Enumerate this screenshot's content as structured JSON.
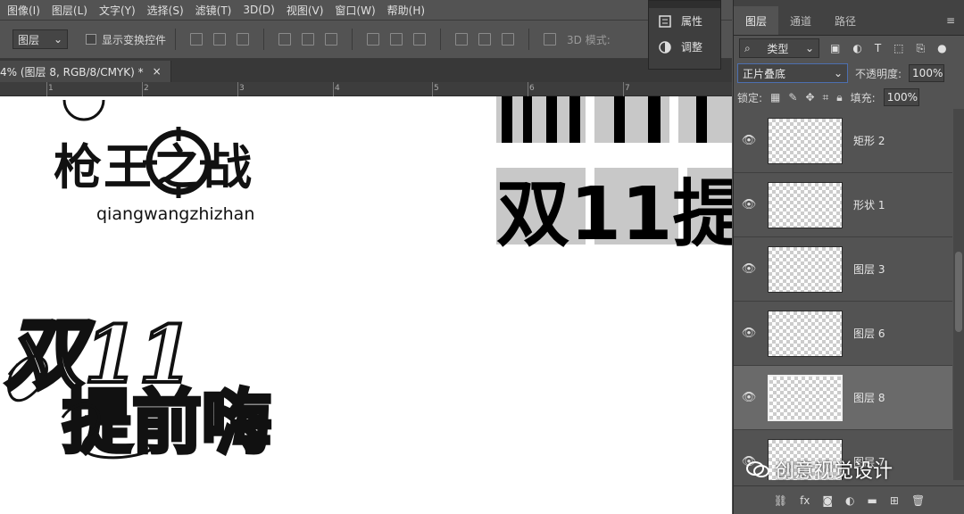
{
  "menu": [
    "图像(I)",
    "图层(L)",
    "文字(Y)",
    "选择(S)",
    "滤镜(T)",
    "3D(D)",
    "视图(V)",
    "窗口(W)",
    "帮助(H)"
  ],
  "options": {
    "select_value": "图层",
    "checkbox_label": "显示变换控件",
    "mode_3d": "3D 模式:"
  },
  "doc_tab": {
    "title": "4% (图层 8, RGB/8/CMYK) *",
    "close": "×"
  },
  "ruler": {
    "ticks": [
      "1",
      "2",
      "3",
      "4",
      "5",
      "6",
      "7"
    ]
  },
  "float_panel": {
    "item1": "属性",
    "item2": "调整"
  },
  "layers_panel": {
    "tabs": [
      "图层",
      "通道",
      "路径"
    ],
    "filter_kind": "类型",
    "blend_mode": "正片叠底",
    "opacity_label": "不透明度:",
    "opacity_value": "100%",
    "lock_label": "锁定:",
    "fill_label": "填充:",
    "fill_value": "100%",
    "layers": [
      {
        "name": "矩形 2"
      },
      {
        "name": "形状 1"
      },
      {
        "name": "图层 3"
      },
      {
        "name": "图层 6"
      },
      {
        "name": "图层 8"
      },
      {
        "name": "图层 7"
      }
    ]
  },
  "canvas": {
    "logo_text": "枪王之战",
    "logo_pinyin": "qiangwangzhizhan",
    "big_title": "双11提",
    "hand_line1": "双11",
    "hand_line2": "提前嗨"
  },
  "watermark": "创意视觉设计"
}
